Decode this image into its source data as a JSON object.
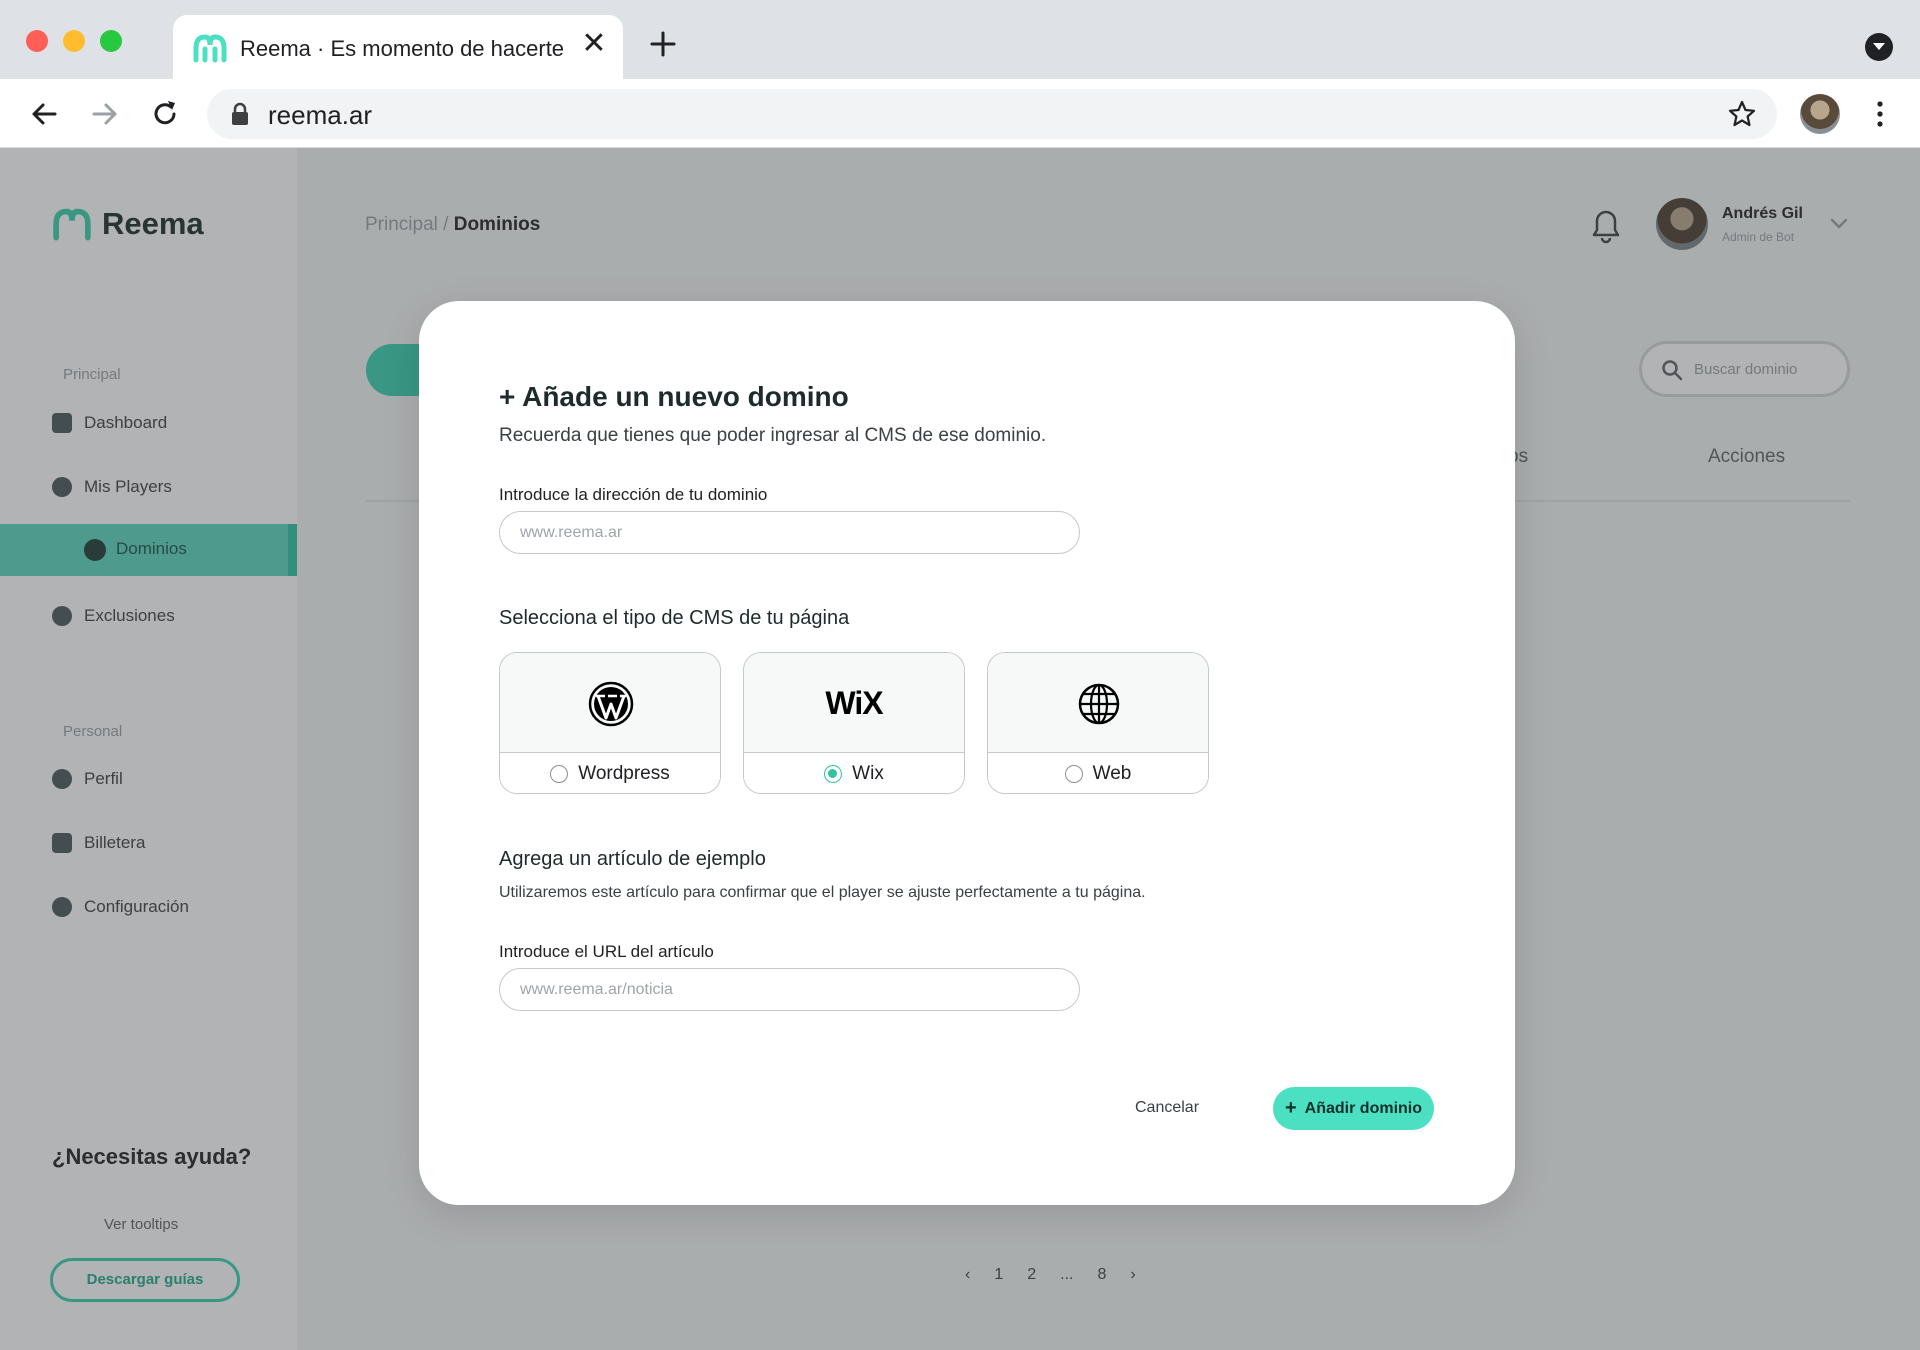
{
  "browser": {
    "tab_title": "Reema · Es momento de hacerte escuchar",
    "url": "reema.ar"
  },
  "app": {
    "brand": "Reema",
    "breadcrumb": {
      "parent": "Principal",
      "separator": "/",
      "current": "Dominios"
    },
    "user": {
      "name": "Andrés Gil",
      "role": "Admin de Bot"
    },
    "search_placeholder": "Buscar dominio",
    "table_headers": {
      "partial": "os",
      "actions": "Acciones"
    },
    "pagination": [
      "‹",
      "1",
      "2",
      "...",
      "8",
      "›"
    ]
  },
  "sidebar": {
    "section_main": "Principal",
    "items_main": [
      "Dashboard",
      "Mis Players",
      "Dominios",
      "Exclusiones"
    ],
    "section_personal": "Personal",
    "items_personal": [
      "Perfil",
      "Billetera",
      "Configuración"
    ],
    "help_title": "¿Necesitas ayuda?",
    "help_link": "Ver tooltips",
    "help_button": "Descargar guías"
  },
  "modal": {
    "title": "+ Añade un nuevo domino",
    "subtitle": "Recuerda que tienes que poder ingresar al CMS de ese dominio.",
    "domain_label": "Introduce la dirección de tu dominio",
    "domain_placeholder": "www.reema.ar",
    "cms_title": "Selecciona el tipo de CMS de tu página",
    "cms_options": [
      {
        "label": "Wordpress",
        "icon": "wordpress-icon",
        "selected": false
      },
      {
        "label": "Wix",
        "icon": "wix-logo",
        "logo_text": "WiX",
        "selected": true
      },
      {
        "label": "Web",
        "icon": "globe-icon",
        "selected": false
      }
    ],
    "article_title": "Agrega un artículo de ejemplo",
    "article_desc": "Utilizaremos este artículo para confirmar que el player se ajuste perfectamente a tu página.",
    "article_label": "Introduce el URL del artículo",
    "article_placeholder": "www.reema.ar/noticia",
    "cancel_label": "Cancelar",
    "add_label": "Añadir dominio"
  },
  "colors": {
    "accent": "#4be0c2",
    "accent_dark": "#2ec3a3",
    "overlay": "#3c4043"
  }
}
